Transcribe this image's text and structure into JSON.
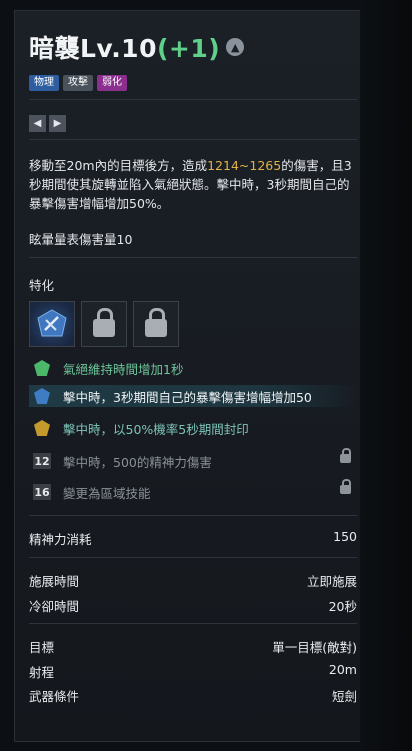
{
  "skill": {
    "name": "暗襲Lv.10",
    "level_bonus": "(+1)",
    "tags": [
      "物理",
      "攻擊",
      "弱化"
    ],
    "description": {
      "part1": "移動至20m內的目標後方，造成",
      "damage": "1214~1265",
      "part2": "的傷害，且3秒期間使其旋轉並陷入氣絕狀態。擊中時，3秒期間自己的暴擊傷害增幅增加50%。"
    },
    "stagger": "眩暈量表傷害量10"
  },
  "traits": {
    "label": "特化",
    "icons": [
      "blue-gem-sword-icon",
      "lock-icon",
      "lock-icon"
    ],
    "rows": [
      {
        "icon": "green-gem-icon",
        "text": "氣絕維持時間增加1秒"
      },
      {
        "icon": "blue-gem-icon",
        "text": "擊中時，3秒期間自己的暴擊傷害增幅增加50"
      },
      {
        "icon": "gold-gem-icon",
        "text": "擊中時，以50%機率5秒期間封印"
      },
      {
        "badge": "12",
        "text": "擊中時，500的精神力傷害"
      },
      {
        "badge": "16",
        "text": "變更為區域技能"
      }
    ]
  },
  "stats": {
    "mana_cost_label": "精神力消耗",
    "mana_cost": "150",
    "cast_time_label": "施展時間",
    "cast_time": "立即施展",
    "cooldown_label": "冷卻時間",
    "cooldown": "20秒",
    "target_label": "目標",
    "target": "單一目標(敵對)",
    "range_label": "射程",
    "range": "20m",
    "weapon_label": "武器條件",
    "weapon": "短劍"
  },
  "colors": {
    "level_bonus": "#5fd08a",
    "damage": "#e0b34a",
    "highlight_row": "#1f3a44"
  }
}
